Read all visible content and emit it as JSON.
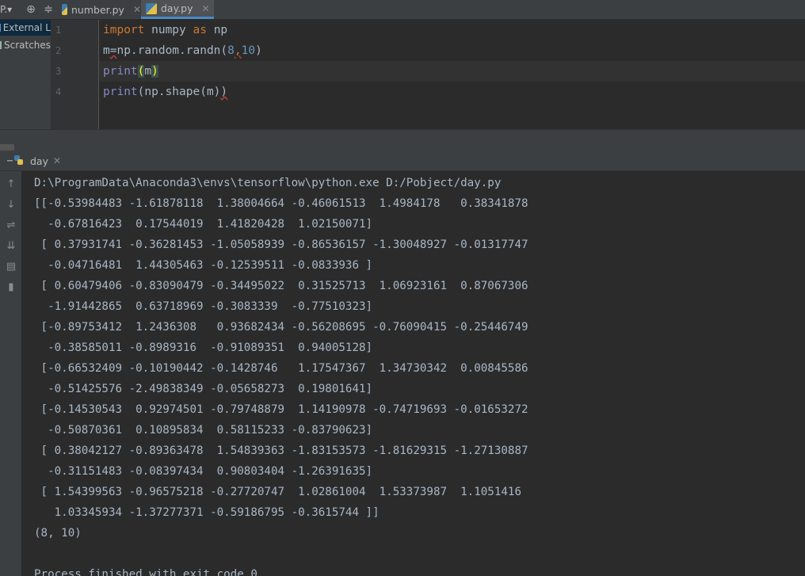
{
  "toolbar": {
    "project_label": "P.▾",
    "icons": [
      "crosshair-icon",
      "split-icon",
      "gear-icon",
      "hide-icon"
    ]
  },
  "tabs": [
    {
      "label": "number.py",
      "active": false
    },
    {
      "label": "day.py",
      "active": true
    }
  ],
  "project_panel": {
    "items": [
      {
        "label": "External L",
        "selected": true,
        "icon": "library-icon"
      },
      {
        "label": "Scratches",
        "selected": false,
        "icon": "scratch-icon"
      }
    ]
  },
  "editor": {
    "line_numbers": [
      "1",
      "2",
      "3",
      "4"
    ],
    "lines": [
      {
        "kw1": "import",
        "t1": " numpy ",
        "kw2": "as",
        "t2": " np"
      },
      {
        "v": "m",
        "eq": "=",
        "t1": "np.random.randn(",
        "n1": "8",
        "comma": ",",
        "n2": "10",
        "t2": ")"
      },
      {
        "fn": "print",
        "lp": "(",
        "arg": "m",
        "rp": ")"
      },
      {
        "fn": "print",
        "t1": "(np.shape(m)",
        "rp": ")"
      }
    ]
  },
  "run": {
    "tab_label": "day",
    "output_lines": [
      "D:\\ProgramData\\Anaconda3\\envs\\tensorflow\\python.exe D:/Pobject/day.py",
      "[[-0.53984483 -1.61878118  1.38004664 -0.46061513  1.4984178   0.38341878",
      "  -0.67816423  0.17544019  1.41820428  1.02150071]",
      " [ 0.37931741 -0.36281453 -1.05058939 -0.86536157 -1.30048927 -0.01317747",
      "  -0.04716481  1.44305463 -0.12539511 -0.0833936 ]",
      " [ 0.60479406 -0.83090479 -0.34495022  0.31525713  1.06923161  0.87067306",
      "  -1.91442865  0.63718969 -0.3083339  -0.77510323]",
      " [-0.89753412  1.2436308   0.93682434 -0.56208695 -0.76090415 -0.25446749",
      "  -0.38585011 -0.8989316  -0.91089351  0.94005128]",
      " [-0.66532409 -0.10190442 -0.1428746   1.17547367  1.34730342  0.00845586",
      "  -0.51425576 -2.49838349 -0.05658273  0.19801641]",
      " [-0.14530543  0.92974501 -0.79748879  1.14190978 -0.74719693 -0.01653272",
      "  -0.50870361  0.10895834  0.58115233 -0.83790623]",
      " [ 0.38042127 -0.89363478  1.54839363 -1.83153573 -1.81629315 -1.27130887",
      "  -0.31151483 -0.08397434  0.90803404 -1.26391635]",
      " [ 1.54399563 -0.96575218 -0.27720747  1.02861004  1.53373987  1.1051416",
      "   1.03345934 -1.37277371 -0.59186795 -0.3615744 ]]",
      "(8, 10)",
      "",
      "Process finished with exit code 0"
    ]
  },
  "colors": {
    "background": "#2b2b2b",
    "panel": "#3c3f41",
    "keyword": "#cc7832",
    "number": "#6897bb",
    "builtin": "#8888c6",
    "text": "#a9b7c6",
    "accent": "#4a88c7"
  }
}
